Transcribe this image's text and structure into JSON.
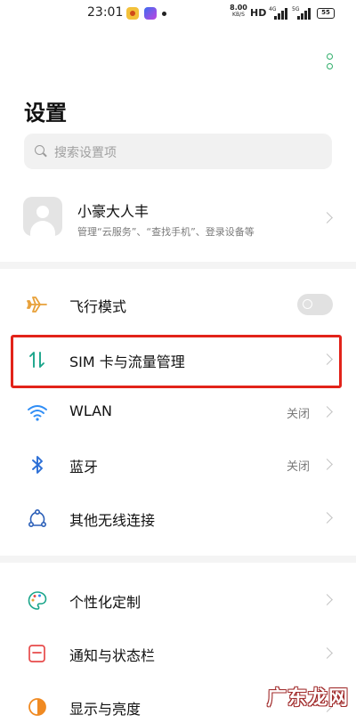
{
  "status_bar": {
    "time": "23:01",
    "net_speed_value": "8.00",
    "net_speed_unit": "KB/S",
    "hd_label": "HD",
    "signal_1_label": "4G",
    "signal_2_label": "5G",
    "battery": "55"
  },
  "page": {
    "title": "设置"
  },
  "search": {
    "placeholder": "搜索设置项"
  },
  "account": {
    "name": "小豪大人丰",
    "subtitle": "管理“云服务”、“查找手机”、登录设备等"
  },
  "settings": {
    "airplane_mode": {
      "label": "飞行模式",
      "icon": "airplane-icon",
      "enabled": false
    },
    "sim": {
      "label": "SIM 卡与流量管理",
      "icon": "sim-data-icon"
    },
    "wlan": {
      "label": "WLAN",
      "value": "关闭",
      "icon": "wifi-icon"
    },
    "bluetooth": {
      "label": "蓝牙",
      "value": "关闭",
      "icon": "bluetooth-icon"
    },
    "other_wireless": {
      "label": "其他无线连接",
      "icon": "wireless-connections-icon"
    },
    "personalization": {
      "label": "个性化定制",
      "icon": "palette-icon"
    },
    "notifications": {
      "label": "通知与状态栏",
      "icon": "notification-icon"
    },
    "display": {
      "label": "显示与亮度",
      "icon": "brightness-icon"
    }
  },
  "watermark": {
    "text": "广东龙网"
  },
  "colors": {
    "highlight_border": "#e2231a",
    "accent_green": "#2fae6a",
    "airplane_orange": "#e8a13a",
    "sim_teal": "#1aa58a",
    "wifi_blue": "#2f8df5",
    "bluetooth_blue": "#2c6fd6",
    "notification_red": "#e74a4a",
    "display_orange": "#f08a22"
  }
}
